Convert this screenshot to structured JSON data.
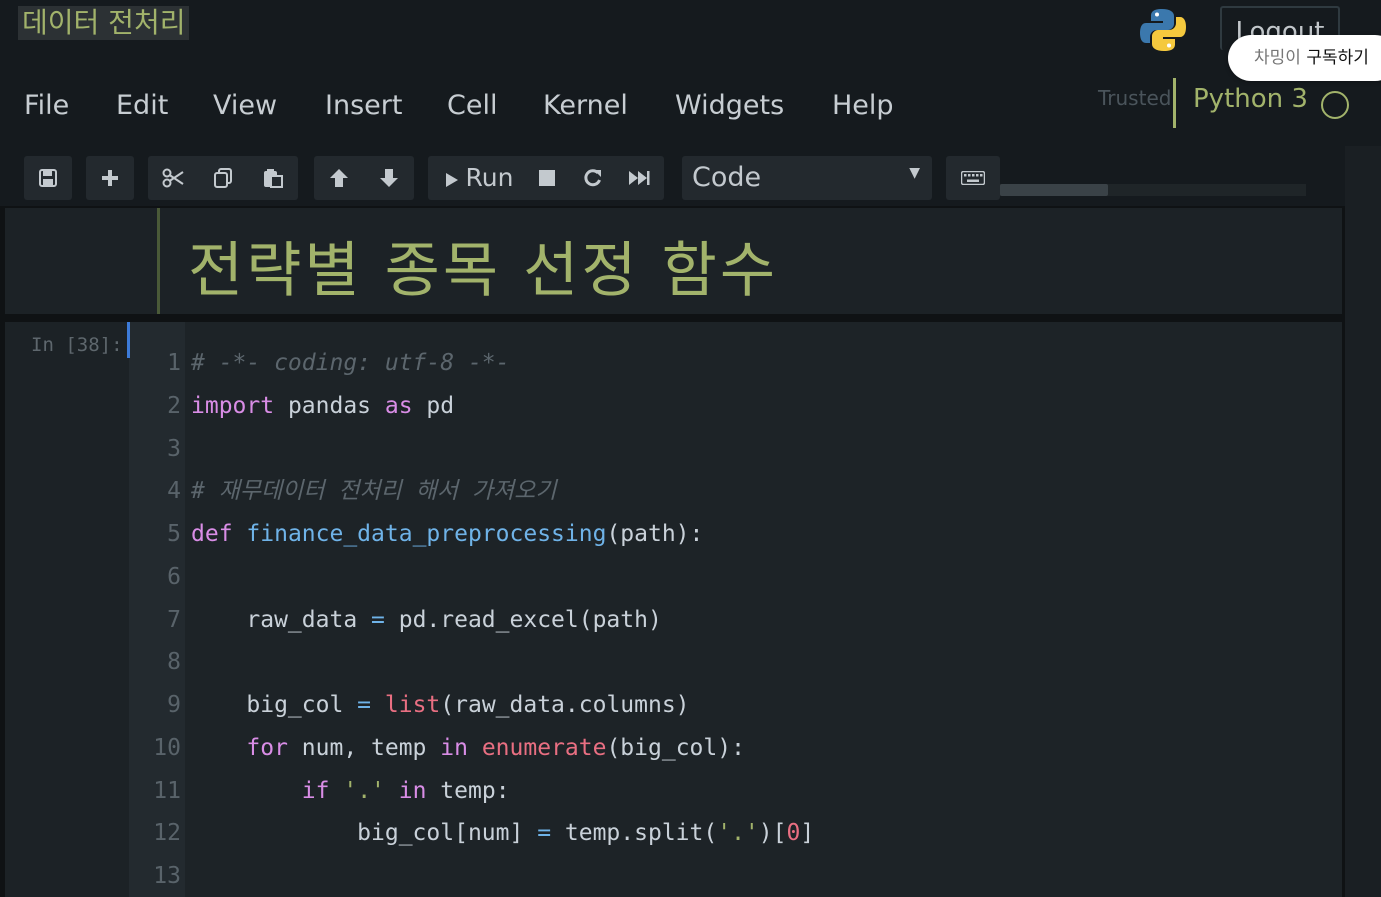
{
  "header": {
    "notebook_title": "데이터 전처리",
    "logout_label": "Logout",
    "tooltip": {
      "channel": "차밍이",
      "action": "구독하기"
    }
  },
  "menu": [
    "File",
    "Edit",
    "View",
    "Insert",
    "Cell",
    "Kernel",
    "Widgets",
    "Help"
  ],
  "status": {
    "trusted": "Trusted",
    "kernel": "Python 3"
  },
  "toolbar": {
    "run_label": "Run",
    "cell_type": "Code",
    "icons": [
      "save-icon",
      "plus-icon",
      "cut-icon",
      "copy-icon",
      "paste-icon",
      "arrow-up-icon",
      "arrow-down-icon",
      "run-icon",
      "stop-icon",
      "restart-icon",
      "fast-forward-icon",
      "keyboard-icon"
    ]
  },
  "markdown_cell": {
    "heading": "전략별 종목 선정 함수"
  },
  "code_cell": {
    "prompt": "In [38]:",
    "lines": [
      {
        "n": "1",
        "tokens": [
          [
            "cm",
            "# -*- coding: utf-8 -*-"
          ]
        ]
      },
      {
        "n": "2",
        "tokens": [
          [
            "kw",
            "import"
          ],
          [
            "pl",
            " pandas "
          ],
          [
            "kw",
            "as"
          ],
          [
            "pl",
            " pd"
          ]
        ]
      },
      {
        "n": "3",
        "tokens": []
      },
      {
        "n": "4",
        "tokens": [
          [
            "cm",
            "# 재무데이터 전처리 해서 가져오기"
          ]
        ]
      },
      {
        "n": "5",
        "tokens": [
          [
            "kw",
            "def"
          ],
          [
            "pl",
            " "
          ],
          [
            "fn",
            "finance_data_preprocessing"
          ],
          [
            "pl",
            "(path):"
          ]
        ]
      },
      {
        "n": "6",
        "tokens": []
      },
      {
        "n": "7",
        "tokens": [
          [
            "pl",
            "    raw_data "
          ],
          [
            "op",
            "="
          ],
          [
            "pl",
            " pd.read_excel(path)"
          ]
        ]
      },
      {
        "n": "8",
        "tokens": []
      },
      {
        "n": "9",
        "tokens": [
          [
            "pl",
            "    big_col "
          ],
          [
            "op",
            "="
          ],
          [
            "pl",
            " "
          ],
          [
            "bi",
            "list"
          ],
          [
            "pl",
            "(raw_data.columns)"
          ]
        ]
      },
      {
        "n": "10",
        "tokens": [
          [
            "pl",
            "    "
          ],
          [
            "kw",
            "for"
          ],
          [
            "pl",
            " num, temp "
          ],
          [
            "kw",
            "in"
          ],
          [
            "pl",
            " "
          ],
          [
            "bi",
            "enumerate"
          ],
          [
            "pl",
            "(big_col):"
          ]
        ]
      },
      {
        "n": "11",
        "tokens": [
          [
            "pl",
            "        "
          ],
          [
            "kw",
            "if"
          ],
          [
            "pl",
            " "
          ],
          [
            "st",
            "'.'"
          ],
          [
            "pl",
            " "
          ],
          [
            "kw",
            "in"
          ],
          [
            "pl",
            " temp:"
          ]
        ]
      },
      {
        "n": "12",
        "tokens": [
          [
            "pl",
            "            big_col[num] "
          ],
          [
            "op",
            "="
          ],
          [
            "pl",
            " temp.split("
          ],
          [
            "st",
            "'.'"
          ],
          [
            "pl",
            ")["
          ],
          [
            "nm",
            "0"
          ],
          [
            "pl",
            "]"
          ]
        ]
      },
      {
        "n": "13",
        "tokens": []
      }
    ]
  }
}
